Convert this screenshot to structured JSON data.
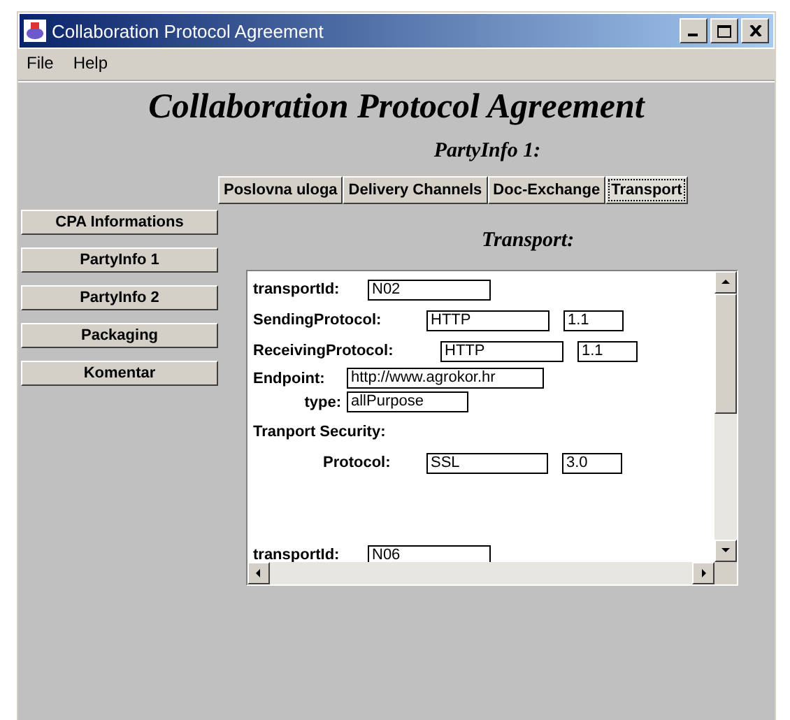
{
  "window": {
    "title": "Collaboration Protocol Agreement"
  },
  "menu": [
    "File",
    "Help"
  ],
  "heading": "Collaboration Protocol Agreement",
  "subheading": "PartyInfo 1:",
  "tabs": [
    {
      "label": "Poslovna uloga",
      "selected": false
    },
    {
      "label": "Delivery Channels",
      "selected": false
    },
    {
      "label": "Doc-Exchange",
      "selected": false
    },
    {
      "label": "Transport",
      "selected": true
    }
  ],
  "sidebar": {
    "items": [
      "CPA Informations",
      "PartyInfo 1",
      "PartyInfo 2",
      "Packaging",
      "Komentar"
    ]
  },
  "panel_title": "Transport:",
  "rows": [
    {
      "kind": "field",
      "label": "transportId:",
      "values": [
        "N02"
      ]
    },
    {
      "kind": "field",
      "label": "SendingProtocol:",
      "values": [
        "HTTP",
        "1.1"
      ]
    },
    {
      "kind": "field",
      "label": "ReceivingProtocol:",
      "values": [
        "HTTP",
        "1.1"
      ]
    },
    {
      "kind": "field",
      "label": "Endpoint:",
      "values": [
        "http://www.agrokor.hr"
      ]
    },
    {
      "kind": "field",
      "label": "type:",
      "values": [
        "allPurpose"
      ]
    },
    {
      "kind": "heading",
      "label": "Tranport Security:"
    },
    {
      "kind": "field",
      "label": "Protocol:",
      "values": [
        "SSL",
        "3.0"
      ]
    },
    {
      "kind": "field",
      "label": "transportId:",
      "values": [
        "N06"
      ]
    }
  ]
}
